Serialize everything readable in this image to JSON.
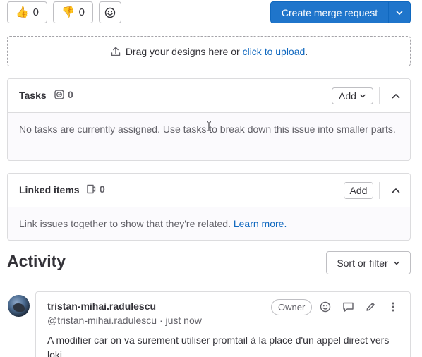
{
  "reactions": {
    "thumbsup_emoji": "👍",
    "thumbsup_count": "0",
    "thumbsdown_emoji": "👎",
    "thumbsdown_count": "0"
  },
  "merge_request": {
    "label": "Create merge request"
  },
  "upload": {
    "text": "Drag your designs here or",
    "link": "click to upload",
    "suffix": "."
  },
  "tasks": {
    "title": "Tasks",
    "count": "0",
    "add_label": "Add",
    "empty_text": "No tasks are currently assigned. Use tasks to break down this issue into smaller parts."
  },
  "linked": {
    "title": "Linked items",
    "count": "0",
    "add_label": "Add",
    "text": "Link issues together to show that they're related.",
    "link": "Learn more."
  },
  "activity": {
    "title": "Activity",
    "sort_label": "Sort or filter"
  },
  "note": {
    "author": "tristan-mihai.radulescu",
    "handle": "@tristan-mihai.radulescu",
    "time": "just now",
    "separator": "·",
    "badge": "Owner",
    "body": "A modifier car on va surement utiliser promtail à la place d'un appel direct vers loki"
  },
  "colors": {
    "primary": "#1f75cb",
    "link": "#1068bf",
    "border": "#dcdcde"
  }
}
